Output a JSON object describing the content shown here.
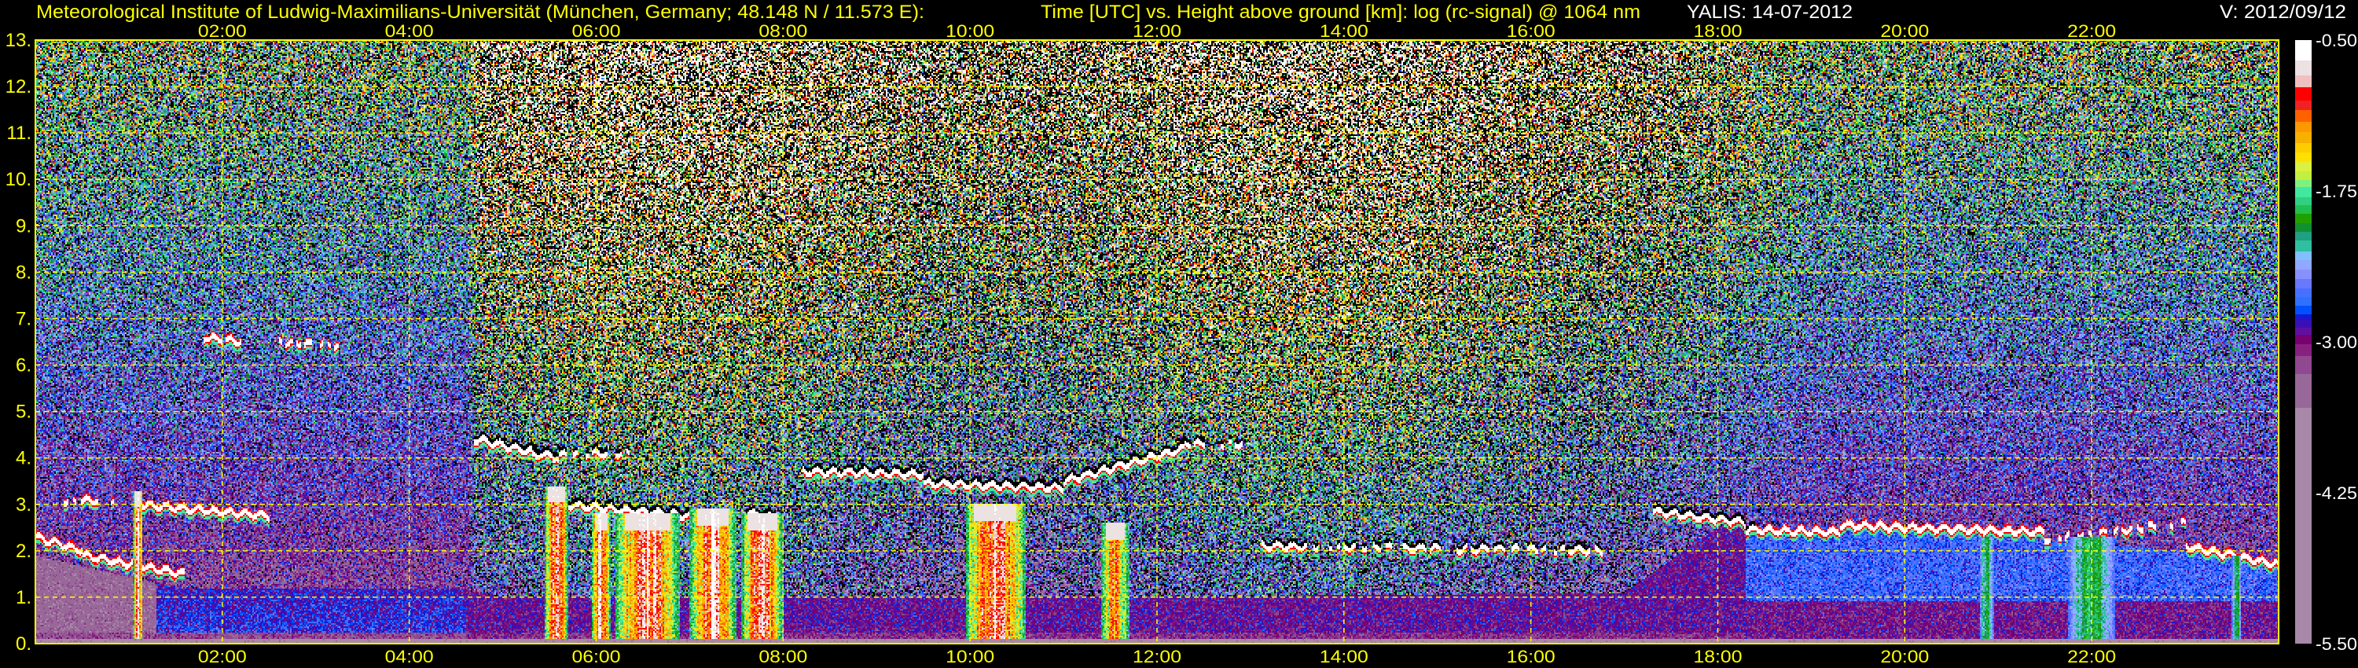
{
  "header": {
    "institute": "Meteorological Institute of Ludwig-Maximilians-Universität (München, Germany; 48.148 N / 11.573 E):",
    "description": "Time [UTC] vs. Height above ground [km]: log (rc-signal) @ 1064 nm",
    "station_date": "YALIS: 14-07-2012",
    "version": "V: 2012/09/12"
  },
  "colors": {
    "axis": "#ffff00",
    "grid": "#ffff00",
    "label_white": "#ffffff",
    "background": "#000000"
  },
  "chart_data": {
    "type": "heatmap",
    "title": "Time [UTC] vs. Height above ground [km]: log (rc-signal) @ 1064 nm",
    "xlabel": "Time [UTC]",
    "ylabel": "Height above ground [km]",
    "xlim": [
      0,
      24
    ],
    "ylim": [
      0,
      13
    ],
    "grid": true,
    "x_ticks": [
      {
        "value": 2,
        "label": "02:00"
      },
      {
        "value": 4,
        "label": "04:00"
      },
      {
        "value": 6,
        "label": "06:00"
      },
      {
        "value": 8,
        "label": "08:00"
      },
      {
        "value": 10,
        "label": "10:00"
      },
      {
        "value": 12,
        "label": "12:00"
      },
      {
        "value": 14,
        "label": "14:00"
      },
      {
        "value": 16,
        "label": "16:00"
      },
      {
        "value": 18,
        "label": "18:00"
      },
      {
        "value": 20,
        "label": "20:00"
      },
      {
        "value": 22,
        "label": "22:00"
      }
    ],
    "y_ticks": [
      {
        "value": 0,
        "label": "0."
      },
      {
        "value": 1,
        "label": "1."
      },
      {
        "value": 2,
        "label": "2."
      },
      {
        "value": 3,
        "label": "3."
      },
      {
        "value": 4,
        "label": "4."
      },
      {
        "value": 5,
        "label": "5."
      },
      {
        "value": 6,
        "label": "6."
      },
      {
        "value": 7,
        "label": "7."
      },
      {
        "value": 8,
        "label": "8."
      },
      {
        "value": 9,
        "label": "9."
      },
      {
        "value": 10,
        "label": "10."
      },
      {
        "value": 11,
        "label": "11."
      },
      {
        "value": 12,
        "label": "12."
      },
      {
        "value": 13,
        "label": "13."
      }
    ],
    "colorbar": {
      "quantity": "log (rc-signal)",
      "range": [
        -5.5,
        -0.5
      ],
      "placement": "right",
      "ticks": [
        {
          "value": -0.5,
          "label": "-0.50"
        },
        {
          "value": -1.75,
          "label": "-1.75"
        },
        {
          "value": -3.0,
          "label": "-3.00"
        },
        {
          "value": -4.25,
          "label": "-4.25"
        },
        {
          "value": -5.5,
          "label": "-5.50"
        }
      ],
      "levels": [
        {
          "from": -0.67,
          "to": -0.5,
          "color": "#ffffff"
        },
        {
          "from": -0.79,
          "to": -0.67,
          "color": "#ece2e2"
        },
        {
          "from": -0.89,
          "to": -0.79,
          "color": "#f0c0c0"
        },
        {
          "from": -1.0,
          "to": -0.89,
          "color": "#ff0000"
        },
        {
          "from": -1.08,
          "to": -1.0,
          "color": "#ee2222"
        },
        {
          "from": -1.18,
          "to": -1.08,
          "color": "#ff6000"
        },
        {
          "from": -1.26,
          "to": -1.18,
          "color": "#ff9800"
        },
        {
          "from": -1.35,
          "to": -1.26,
          "color": "#f8b000"
        },
        {
          "from": -1.43,
          "to": -1.35,
          "color": "#ffcc00"
        },
        {
          "from": -1.51,
          "to": -1.43,
          "color": "#ffe000"
        },
        {
          "from": -1.59,
          "to": -1.51,
          "color": "#dcf040"
        },
        {
          "from": -1.66,
          "to": -1.59,
          "color": "#c0f040"
        },
        {
          "from": -1.72,
          "to": -1.66,
          "color": "#80f080"
        },
        {
          "from": -1.8,
          "to": -1.72,
          "color": "#40e8a0"
        },
        {
          "from": -1.87,
          "to": -1.8,
          "color": "#30d080"
        },
        {
          "from": -1.94,
          "to": -1.87,
          "color": "#20c050"
        },
        {
          "from": -2.02,
          "to": -1.94,
          "color": "#20a000"
        },
        {
          "from": -2.09,
          "to": -2.02,
          "color": "#109030"
        },
        {
          "from": -2.16,
          "to": -2.09,
          "color": "#20a080"
        },
        {
          "from": -2.25,
          "to": -2.16,
          "color": "#30c0a0"
        },
        {
          "from": -2.32,
          "to": -2.25,
          "color": "#80c0ff"
        },
        {
          "from": -2.4,
          "to": -2.32,
          "color": "#90a8ff"
        },
        {
          "from": -2.48,
          "to": -2.4,
          "color": "#8890ff"
        },
        {
          "from": -2.56,
          "to": -2.48,
          "color": "#6878ff"
        },
        {
          "from": -2.63,
          "to": -2.56,
          "color": "#4870ff"
        },
        {
          "from": -2.7,
          "to": -2.63,
          "color": "#3070ff"
        },
        {
          "from": -2.77,
          "to": -2.7,
          "color": "#0050ff"
        },
        {
          "from": -2.82,
          "to": -2.77,
          "color": "#1818d0"
        },
        {
          "from": -2.88,
          "to": -2.82,
          "color": "#3810b8"
        },
        {
          "from": -2.94,
          "to": -2.88,
          "color": "#6010a0"
        },
        {
          "from": -3.02,
          "to": -2.94,
          "color": "#780070"
        },
        {
          "from": -3.12,
          "to": -3.02,
          "color": "#882080"
        },
        {
          "from": -3.27,
          "to": -3.12,
          "color": "#904890"
        },
        {
          "from": -3.55,
          "to": -3.27,
          "color": "#986898"
        },
        {
          "from": -5.5,
          "to": -3.55,
          "color": "#a888a8"
        }
      ]
    },
    "features": {
      "daytime_noise_period_hours": [
        4.65,
        17.0
      ],
      "aerosol_layer_top_km": [
        [
          0,
          1.9
        ],
        [
          1.5,
          1.2
        ],
        [
          4.5,
          1.2
        ],
        [
          5,
          1.0
        ],
        [
          12,
          1.0
        ],
        [
          17,
          1.1
        ],
        [
          18,
          2.5
        ],
        [
          19.5,
          2.5
        ],
        [
          21,
          2.3
        ],
        [
          23,
          2.0
        ],
        [
          24,
          1.6
        ]
      ],
      "cloud_layers": [
        {
          "t": [
            0.0,
            0.5
          ],
          "h": [
            2.3,
            2.0
          ],
          "broken": false
        },
        {
          "t": [
            0.5,
            1.6
          ],
          "h": [
            1.9,
            1.5
          ],
          "broken": false
        },
        {
          "t": [
            0.3,
            0.9
          ],
          "h": [
            3.05,
            3.1
          ],
          "broken": true
        },
        {
          "t": [
            1.1,
            2.5
          ],
          "h": [
            3.0,
            2.75
          ],
          "broken": false
        },
        {
          "t": [
            1.8,
            2.2
          ],
          "h": [
            6.6,
            6.5
          ],
          "broken": true
        },
        {
          "t": [
            2.6,
            3.3
          ],
          "h": [
            6.5,
            6.4
          ],
          "broken": true
        },
        {
          "t": [
            4.7,
            5.6
          ],
          "h": [
            4.4,
            4.0
          ],
          "broken": false
        },
        {
          "t": [
            5.3,
            6.4
          ],
          "h": [
            4.05,
            4.1
          ],
          "broken": true
        },
        {
          "t": [
            5.6,
            7.0
          ],
          "h": [
            3.0,
            2.75
          ],
          "broken": false
        },
        {
          "t": [
            7.6,
            8.0
          ],
          "h": [
            2.8,
            2.7
          ],
          "broken": false
        },
        {
          "t": [
            8.2,
            9.5
          ],
          "h": [
            3.7,
            3.65
          ],
          "broken": false
        },
        {
          "t": [
            9.5,
            11.0
          ],
          "h": [
            3.45,
            3.35
          ],
          "broken": false
        },
        {
          "t": [
            11.0,
            12.3
          ],
          "h": [
            3.5,
            4.2
          ],
          "broken": false
        },
        {
          "t": [
            12.3,
            13.0
          ],
          "h": [
            4.3,
            4.3
          ],
          "broken": true
        },
        {
          "t": [
            13.0,
            16.8
          ],
          "h": [
            2.1,
            2.0
          ],
          "broken": true
        },
        {
          "t": [
            17.3,
            18.3
          ],
          "h": [
            2.85,
            2.6
          ],
          "broken": false
        },
        {
          "t": [
            18.3,
            19.3
          ],
          "h": [
            2.45,
            2.4
          ],
          "broken": false
        },
        {
          "t": [
            19.3,
            21.5
          ],
          "h": [
            2.55,
            2.4
          ],
          "broken": false
        },
        {
          "t": [
            21.5,
            23.0
          ],
          "h": [
            2.25,
            2.6
          ],
          "broken": true
        },
        {
          "t": [
            23.0,
            24.0
          ],
          "h": [
            2.1,
            1.7
          ],
          "broken": false
        }
      ],
      "precipitation_fallstreaks": [
        {
          "t": [
            1.05,
            1.15
          ],
          "top_km": 3.3,
          "strength": "strong"
        },
        {
          "t": [
            5.45,
            5.7
          ],
          "top_km": 3.4,
          "strength": "strong"
        },
        {
          "t": [
            5.95,
            6.15
          ],
          "top_km": 2.8,
          "strength": "strong"
        },
        {
          "t": [
            6.2,
            6.9
          ],
          "top_km": 2.8,
          "strength": "strong"
        },
        {
          "t": [
            7.0,
            7.5
          ],
          "top_km": 2.9,
          "strength": "strong"
        },
        {
          "t": [
            7.55,
            8.0
          ],
          "top_km": 2.8,
          "strength": "strong"
        },
        {
          "t": [
            9.95,
            10.6
          ],
          "top_km": 3.0,
          "strength": "strong"
        },
        {
          "t": [
            11.4,
            11.7
          ],
          "top_km": 2.6,
          "strength": "medium"
        },
        {
          "t": [
            20.8,
            20.95
          ],
          "top_km": 2.3,
          "strength": "weak"
        },
        {
          "t": [
            21.75,
            22.25
          ],
          "top_km": 2.3,
          "strength": "weak"
        },
        {
          "t": [
            23.5,
            23.6
          ],
          "top_km": 1.9,
          "strength": "weak"
        }
      ]
    }
  }
}
